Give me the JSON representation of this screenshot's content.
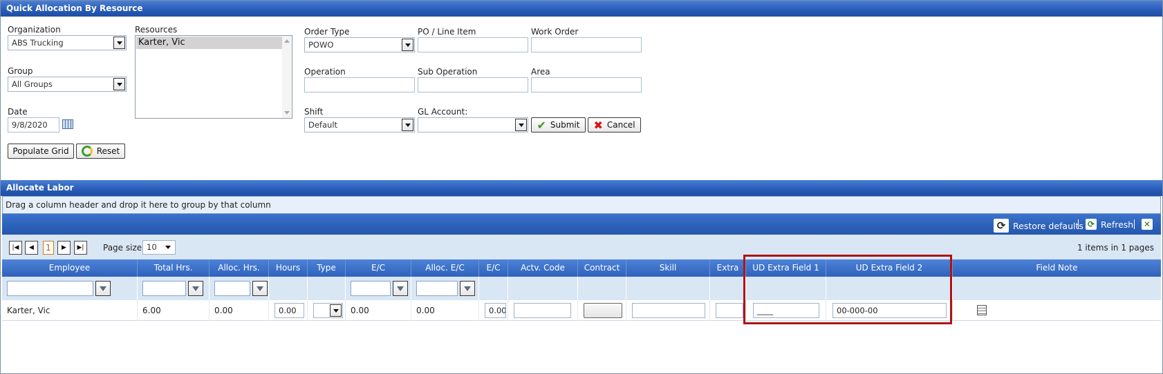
{
  "top_panel": {
    "title": "Quick Allocation By Resource",
    "organization": {
      "label": "Organization",
      "value": "ABS Trucking"
    },
    "group": {
      "label": "Group",
      "value": "All Groups"
    },
    "date": {
      "label": "Date",
      "value": "9/8/2020"
    },
    "resources": {
      "label": "Resources",
      "selected": "Karter, Vic"
    },
    "order_type": {
      "label": "Order Type",
      "value": "POWO"
    },
    "po_line_item": {
      "label": "PO / Line Item",
      "value": ""
    },
    "work_order": {
      "label": "Work Order",
      "value": ""
    },
    "operation": {
      "label": "Operation",
      "value": ""
    },
    "sub_operation": {
      "label": "Sub Operation",
      "value": ""
    },
    "area": {
      "label": "Area",
      "value": ""
    },
    "shift": {
      "label": "Shift",
      "value": "Default"
    },
    "gl_account": {
      "label": "GL Account:",
      "value": ""
    },
    "submit_label": "Submit",
    "cancel_label": "Cancel",
    "populate_label": "Populate Grid",
    "reset_label": "Reset"
  },
  "allocate_panel": {
    "title": "Allocate Labor",
    "group_hint": "Drag a column header and drop it here to group by that column",
    "toolbar": {
      "restore_label": "Restore defaults",
      "refresh_label": "Refresh",
      "separator": "|"
    },
    "pager": {
      "current_page": "1",
      "page_size_label": "Page size:",
      "page_size": "10",
      "summary": "1 items in 1 pages"
    },
    "columns": [
      "Employee",
      "Total Hrs.",
      "Alloc. Hrs.",
      "Hours",
      "Type",
      "E/C",
      "Alloc. E/C",
      "E/C",
      "Actv. Code",
      "Contract",
      "Skill",
      "Extra",
      "UD Extra Field 1",
      "UD Extra Field 2",
      "Field Note"
    ],
    "row": {
      "employee": "Karter, Vic",
      "total_hrs": "6.00",
      "alloc_hrs": "0.00",
      "hours": "0.00",
      "ec": "0.00",
      "alloc_ec": "0.00",
      "ec2": "0.00",
      "ud1": "____",
      "ud2": "00-000-00"
    }
  },
  "colors": {
    "header_blue": "#2f62bb",
    "highlight_red": "#b01212"
  }
}
